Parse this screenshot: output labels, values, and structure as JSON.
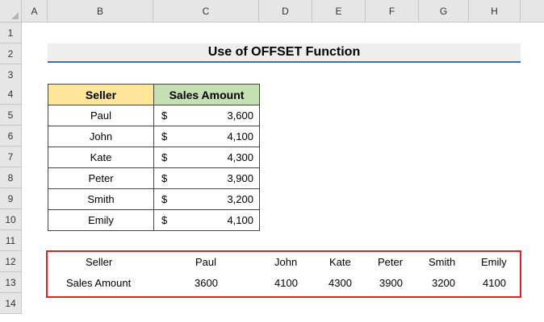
{
  "columns": [
    "A",
    "B",
    "C",
    "D",
    "E",
    "F",
    "G",
    "H"
  ],
  "rows": [
    "1",
    "2",
    "3",
    "4",
    "5",
    "6",
    "7",
    "8",
    "9",
    "10",
    "11",
    "12",
    "13",
    "14"
  ],
  "title": "Use of OFFSET Function",
  "table": {
    "headers": [
      "Seller",
      "Sales Amount"
    ],
    "currency": "$",
    "rows": [
      {
        "seller": "Paul",
        "amount": "3,600"
      },
      {
        "seller": "John",
        "amount": "4,100"
      },
      {
        "seller": "Kate",
        "amount": "4,300"
      },
      {
        "seller": "Peter",
        "amount": "3,900"
      },
      {
        "seller": "Smith",
        "amount": "3,200"
      },
      {
        "seller": "Emily",
        "amount": "4,100"
      }
    ]
  },
  "result": {
    "labels": [
      "Seller",
      "Sales Amount"
    ],
    "sellers": [
      "Paul",
      "John",
      "Kate",
      "Peter",
      "Smith",
      "Emily"
    ],
    "amounts": [
      "3600",
      "4100",
      "4300",
      "3900",
      "3200",
      "4100"
    ]
  },
  "colors": {
    "seller_header": "#ffe699",
    "amount_header": "#c6e0b4",
    "highlight_border": "#e0202a",
    "title_underline": "#3d6fb3"
  }
}
